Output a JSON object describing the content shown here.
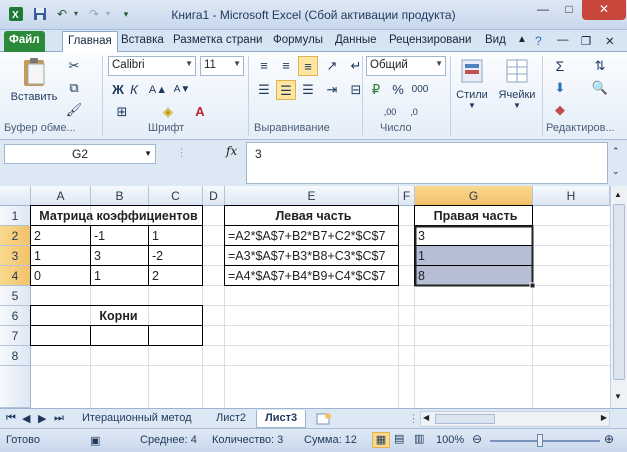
{
  "window": {
    "title": "Книга1  -  Microsoft Excel (Сбой активации продукта)",
    "minimize": "—",
    "maximize": "□",
    "close": "✕"
  },
  "tabs": [
    "Файл",
    "Главная",
    "Вставка",
    "Разметка страни",
    "Формулы",
    "Данные",
    "Рецензировани",
    "Вид"
  ],
  "ribbon": {
    "paste_label": "Вставить",
    "font_name": "Calibri",
    "font_size": "11",
    "number_format": "Общий",
    "styles_label": "Стили",
    "cells_label": "Ячейки",
    "groups": [
      "Буфер обме...",
      "Шрифт",
      "Выравнивание",
      "Число",
      "Редактиров..."
    ]
  },
  "formula_bar": {
    "name_box": "G2",
    "fx": "fx",
    "formula": "3"
  },
  "columns": [
    "A",
    "B",
    "C",
    "D",
    "E",
    "F",
    "G",
    "H"
  ],
  "rows": [
    "1",
    "2",
    "3",
    "4",
    "5",
    "6",
    "7",
    "8"
  ],
  "cells": {
    "A1": "Матрица коэффициентов",
    "E1": "Левая часть",
    "G1": "Правая часть",
    "A2": "2",
    "B2": "-1",
    "C2": "1",
    "E2": "=A2*$A$7+B2*B7+C2*$C$7",
    "G2": "3",
    "A3": "1",
    "B3": "3",
    "C3": "-2",
    "E3": "=A3*$A$7+B3*B8+C3*$C$7",
    "G3": "1",
    "A4": "0",
    "B4": "1",
    "C4": "2",
    "E4": "=A4*$A$7+B4*B9+C4*$C$7",
    "G4": "8",
    "A6": "Корни"
  },
  "sheets": [
    "Итерационный метод",
    "Лист2",
    "Лист3"
  ],
  "active_sheet": "Лист3",
  "status": {
    "ready": "Готово",
    "average": "Среднее: 4",
    "count": "Количество: 3",
    "sum": "Сумма: 12",
    "zoom": "100%"
  },
  "colors": {
    "file_tab": "#2a8a3a",
    "selection_fill": "#b6bed6",
    "header_selected": "#f2c16a"
  }
}
